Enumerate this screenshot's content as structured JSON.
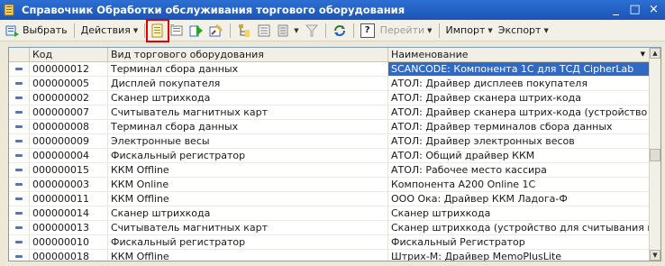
{
  "window": {
    "title": "Справочник Обработки обслуживания торгового оборудования",
    "minimize": "_",
    "close": "×"
  },
  "toolbar": {
    "select_label": "Выбрать",
    "actions_label": "Действия",
    "goto_label": "Перейти",
    "import_label": "Импорт",
    "export_label": "Экспорт",
    "help_label": "?"
  },
  "grid": {
    "columns": [
      "Код",
      "Вид торгового оборудования",
      "Наименование"
    ],
    "rows": [
      {
        "code": "000000012",
        "type": "Терминал сбора данных",
        "name": "SCANCODE: Компонента 1С для ТСД CipherLab"
      },
      {
        "code": "000000005",
        "type": "Дисплей покупателя",
        "name": "АТОЛ: Драйвер дисплеев покупателя"
      },
      {
        "code": "000000002",
        "type": "Сканер штрихкода",
        "name": "АТОЛ: Драйвер сканера штрих-кода"
      },
      {
        "code": "000000007",
        "type": "Считыватель магнитных карт",
        "name": "АТОЛ: Драйвер сканера штрих-кода (устройство для с"
      },
      {
        "code": "000000008",
        "type": "Терминал сбора данных",
        "name": "АТОЛ: Драйвер терминалов сбора данных"
      },
      {
        "code": "000000009",
        "type": "Электронные весы",
        "name": "АТОЛ: Драйвер электронных весов"
      },
      {
        "code": "000000004",
        "type": "Фискальный регистратор",
        "name": "АТОЛ: Общий драйвер ККМ"
      },
      {
        "code": "000000015",
        "type": "ККМ Offline",
        "name": "АТОЛ: Рабочее место кассира"
      },
      {
        "code": "000000003",
        "type": "ККМ Online",
        "name": "Компонента A200 Online 1С"
      },
      {
        "code": "000000011",
        "type": "ККМ Offline",
        "name": "ООО Ока: Драйвер ККМ Ладога-Ф"
      },
      {
        "code": "000000014",
        "type": "Сканер штрихкода",
        "name": "Сканер штрихкода"
      },
      {
        "code": "000000013",
        "type": "Считыватель магнитных карт",
        "name": "Сканер штрихкода (устройство для считывания магнит"
      },
      {
        "code": "000000010",
        "type": "Фискальный регистратор",
        "name": "Фискальный Регистратор"
      },
      {
        "code": "000000018",
        "type": "ККМ Offline",
        "name": "Штрих-М: Драйвер МеmоPlusLite"
      }
    ]
  },
  "colors": {
    "titlebar": "#1b54b6",
    "selection": "#316ac5",
    "highlight": "#e00000"
  }
}
